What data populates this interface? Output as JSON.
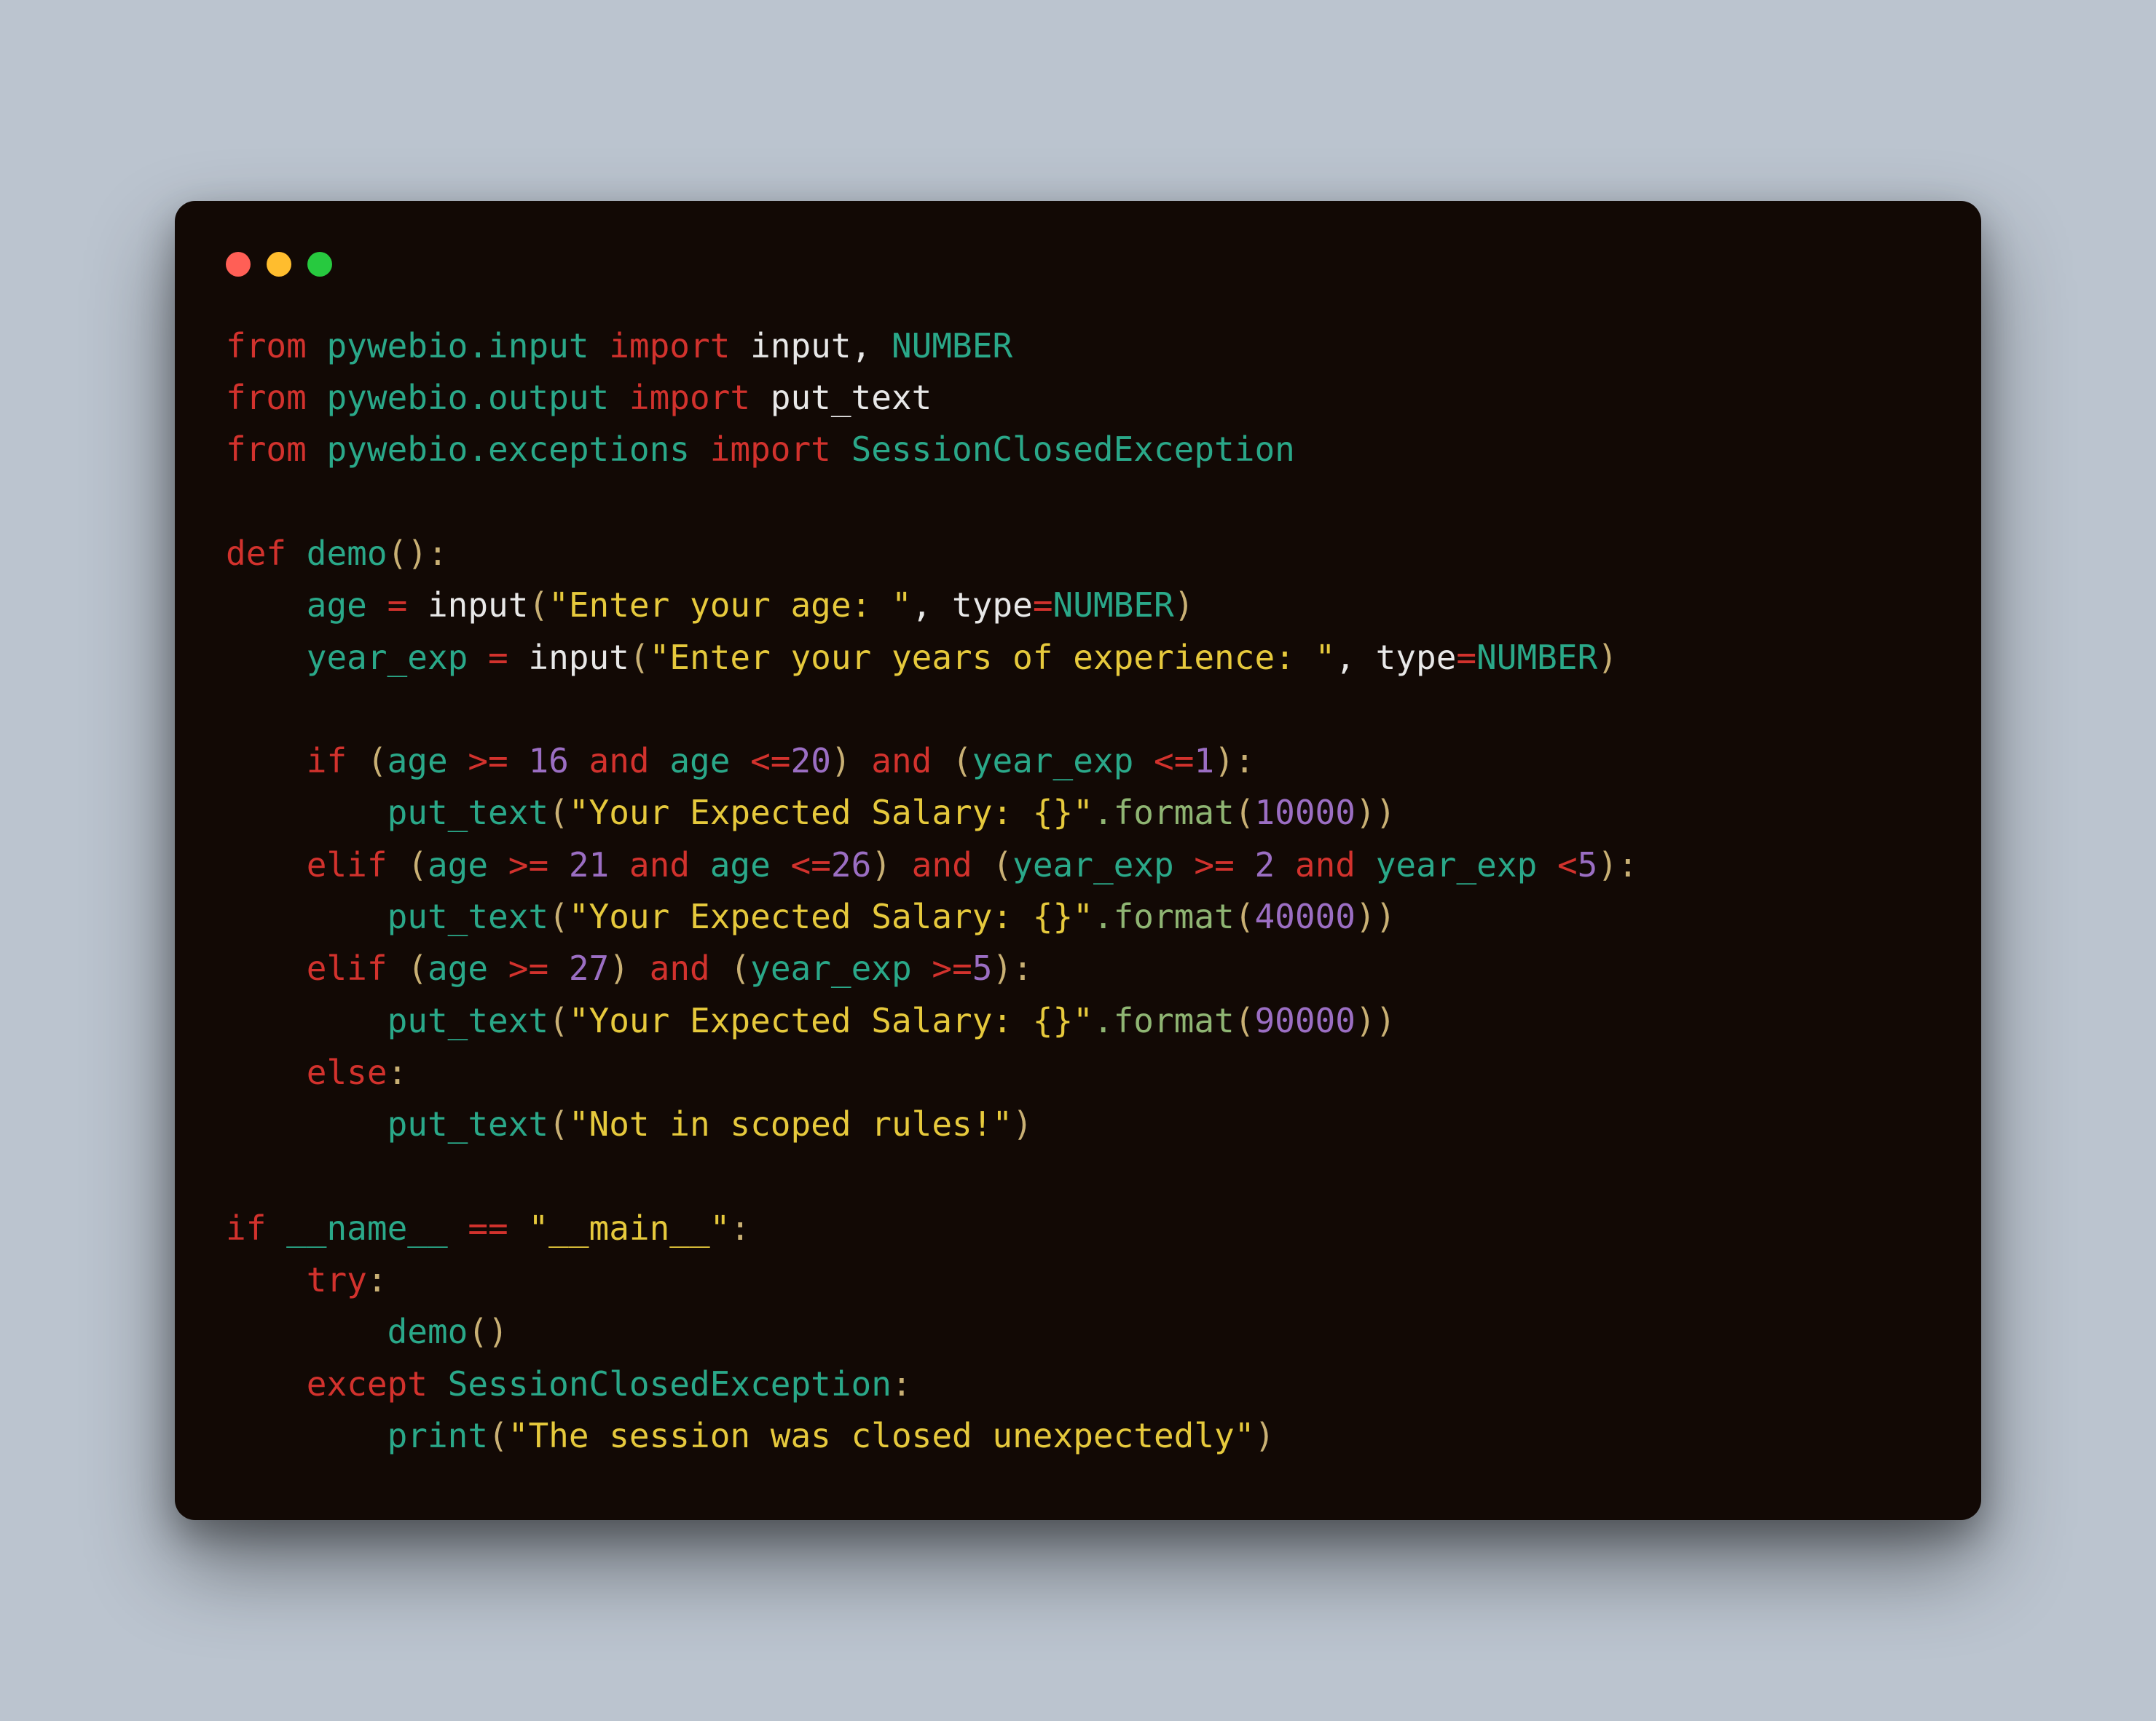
{
  "code": {
    "lines": [
      [
        {
          "t": "from ",
          "c": "kw"
        },
        {
          "t": "pywebio.input ",
          "c": "mod"
        },
        {
          "t": "import ",
          "c": "kw"
        },
        {
          "t": "input",
          "c": "white"
        },
        {
          "t": ", ",
          "c": "white"
        },
        {
          "t": "NUMBER",
          "c": "const"
        }
      ],
      [
        {
          "t": "from ",
          "c": "kw"
        },
        {
          "t": "pywebio.output ",
          "c": "mod"
        },
        {
          "t": "import ",
          "c": "kw"
        },
        {
          "t": "put_text",
          "c": "white"
        }
      ],
      [
        {
          "t": "from ",
          "c": "kw"
        },
        {
          "t": "pywebio.exceptions ",
          "c": "mod"
        },
        {
          "t": "import ",
          "c": "kw"
        },
        {
          "t": "SessionClosedException",
          "c": "const"
        }
      ],
      [],
      [
        {
          "t": "def ",
          "c": "kw"
        },
        {
          "t": "demo",
          "c": "name"
        },
        {
          "t": "():",
          "c": "par"
        }
      ],
      [
        {
          "t": "    ",
          "c": "white"
        },
        {
          "t": "age ",
          "c": "name"
        },
        {
          "t": "= ",
          "c": "op"
        },
        {
          "t": "input",
          "c": "white"
        },
        {
          "t": "(",
          "c": "par"
        },
        {
          "t": "\"Enter your age: \"",
          "c": "str"
        },
        {
          "t": ", ",
          "c": "white"
        },
        {
          "t": "type",
          "c": "white"
        },
        {
          "t": "=",
          "c": "op"
        },
        {
          "t": "NUMBER",
          "c": "const"
        },
        {
          "t": ")",
          "c": "par"
        }
      ],
      [
        {
          "t": "    ",
          "c": "white"
        },
        {
          "t": "year_exp ",
          "c": "name"
        },
        {
          "t": "= ",
          "c": "op"
        },
        {
          "t": "input",
          "c": "white"
        },
        {
          "t": "(",
          "c": "par"
        },
        {
          "t": "\"Enter your years of experience: \"",
          "c": "str"
        },
        {
          "t": ", ",
          "c": "white"
        },
        {
          "t": "type",
          "c": "white"
        },
        {
          "t": "=",
          "c": "op"
        },
        {
          "t": "NUMBER",
          "c": "const"
        },
        {
          "t": ")",
          "c": "par"
        }
      ],
      [],
      [
        {
          "t": "    ",
          "c": "white"
        },
        {
          "t": "if ",
          "c": "kw"
        },
        {
          "t": "(",
          "c": "par"
        },
        {
          "t": "age ",
          "c": "name"
        },
        {
          "t": ">= ",
          "c": "op"
        },
        {
          "t": "16",
          "c": "num"
        },
        {
          "t": " and ",
          "c": "kw"
        },
        {
          "t": "age ",
          "c": "name"
        },
        {
          "t": "<=",
          "c": "op"
        },
        {
          "t": "20",
          "c": "num"
        },
        {
          "t": ")",
          "c": "par"
        },
        {
          "t": " and ",
          "c": "kw"
        },
        {
          "t": "(",
          "c": "par"
        },
        {
          "t": "year_exp ",
          "c": "name"
        },
        {
          "t": "<=",
          "c": "op"
        },
        {
          "t": "1",
          "c": "num"
        },
        {
          "t": "):",
          "c": "par"
        }
      ],
      [
        {
          "t": "        ",
          "c": "white"
        },
        {
          "t": "put_text",
          "c": "name"
        },
        {
          "t": "(",
          "c": "par"
        },
        {
          "t": "\"Your Expected Salary: {}\"",
          "c": "str"
        },
        {
          "t": ".format",
          "c": "attr"
        },
        {
          "t": "(",
          "c": "par"
        },
        {
          "t": "10000",
          "c": "num"
        },
        {
          "t": "))",
          "c": "par"
        }
      ],
      [
        {
          "t": "    ",
          "c": "white"
        },
        {
          "t": "elif ",
          "c": "kw"
        },
        {
          "t": "(",
          "c": "par"
        },
        {
          "t": "age ",
          "c": "name"
        },
        {
          "t": ">= ",
          "c": "op"
        },
        {
          "t": "21",
          "c": "num"
        },
        {
          "t": " and ",
          "c": "kw"
        },
        {
          "t": "age ",
          "c": "name"
        },
        {
          "t": "<=",
          "c": "op"
        },
        {
          "t": "26",
          "c": "num"
        },
        {
          "t": ")",
          "c": "par"
        },
        {
          "t": " and ",
          "c": "kw"
        },
        {
          "t": "(",
          "c": "par"
        },
        {
          "t": "year_exp ",
          "c": "name"
        },
        {
          "t": ">= ",
          "c": "op"
        },
        {
          "t": "2",
          "c": "num"
        },
        {
          "t": " and ",
          "c": "kw"
        },
        {
          "t": "year_exp ",
          "c": "name"
        },
        {
          "t": "<",
          "c": "op"
        },
        {
          "t": "5",
          "c": "num"
        },
        {
          "t": "):",
          "c": "par"
        }
      ],
      [
        {
          "t": "        ",
          "c": "white"
        },
        {
          "t": "put_text",
          "c": "name"
        },
        {
          "t": "(",
          "c": "par"
        },
        {
          "t": "\"Your Expected Salary: {}\"",
          "c": "str"
        },
        {
          "t": ".format",
          "c": "attr"
        },
        {
          "t": "(",
          "c": "par"
        },
        {
          "t": "40000",
          "c": "num"
        },
        {
          "t": "))",
          "c": "par"
        }
      ],
      [
        {
          "t": "    ",
          "c": "white"
        },
        {
          "t": "elif ",
          "c": "kw"
        },
        {
          "t": "(",
          "c": "par"
        },
        {
          "t": "age ",
          "c": "name"
        },
        {
          "t": ">= ",
          "c": "op"
        },
        {
          "t": "27",
          "c": "num"
        },
        {
          "t": ")",
          "c": "par"
        },
        {
          "t": " and ",
          "c": "kw"
        },
        {
          "t": "(",
          "c": "par"
        },
        {
          "t": "year_exp ",
          "c": "name"
        },
        {
          "t": ">=",
          "c": "op"
        },
        {
          "t": "5",
          "c": "num"
        },
        {
          "t": "):",
          "c": "par"
        }
      ],
      [
        {
          "t": "        ",
          "c": "white"
        },
        {
          "t": "put_text",
          "c": "name"
        },
        {
          "t": "(",
          "c": "par"
        },
        {
          "t": "\"Your Expected Salary: {}\"",
          "c": "str"
        },
        {
          "t": ".format",
          "c": "attr"
        },
        {
          "t": "(",
          "c": "par"
        },
        {
          "t": "90000",
          "c": "num"
        },
        {
          "t": "))",
          "c": "par"
        }
      ],
      [
        {
          "t": "    ",
          "c": "white"
        },
        {
          "t": "else",
          "c": "kw"
        },
        {
          "t": ":",
          "c": "par"
        }
      ],
      [
        {
          "t": "        ",
          "c": "white"
        },
        {
          "t": "put_text",
          "c": "name"
        },
        {
          "t": "(",
          "c": "par"
        },
        {
          "t": "\"Not in scoped rules!\"",
          "c": "str"
        },
        {
          "t": ")",
          "c": "par"
        }
      ],
      [],
      [
        {
          "t": "if ",
          "c": "kw"
        },
        {
          "t": "__name__ ",
          "c": "name"
        },
        {
          "t": "== ",
          "c": "op"
        },
        {
          "t": "\"__main__\"",
          "c": "str"
        },
        {
          "t": ":",
          "c": "par"
        }
      ],
      [
        {
          "t": "    ",
          "c": "white"
        },
        {
          "t": "try",
          "c": "kw"
        },
        {
          "t": ":",
          "c": "par"
        }
      ],
      [
        {
          "t": "        ",
          "c": "white"
        },
        {
          "t": "demo",
          "c": "name"
        },
        {
          "t": "()",
          "c": "par"
        }
      ],
      [
        {
          "t": "    ",
          "c": "white"
        },
        {
          "t": "except ",
          "c": "kw"
        },
        {
          "t": "SessionClosedException",
          "c": "const"
        },
        {
          "t": ":",
          "c": "par"
        }
      ],
      [
        {
          "t": "        ",
          "c": "white"
        },
        {
          "t": "print",
          "c": "name"
        },
        {
          "t": "(",
          "c": "par"
        },
        {
          "t": "\"The session was closed unexpectedly\"",
          "c": "str"
        },
        {
          "t": ")",
          "c": "par"
        }
      ]
    ]
  }
}
